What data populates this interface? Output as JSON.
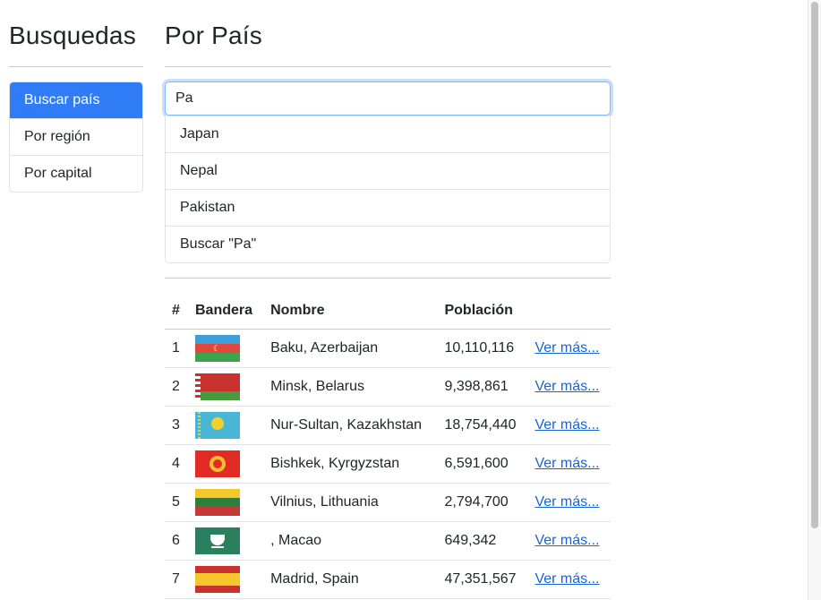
{
  "sidebar": {
    "title": "Busquedas",
    "items": [
      {
        "label": "Buscar país",
        "active": true
      },
      {
        "label": "Por región",
        "active": false
      },
      {
        "label": "Por capital",
        "active": false
      }
    ]
  },
  "main": {
    "title": "Por País",
    "search": {
      "value": "Pa",
      "placeholder": ""
    },
    "suggestions": [
      "Japan",
      "Nepal",
      "Pakistan",
      "Buscar \"Pa\""
    ],
    "table": {
      "headers": [
        "#",
        "Bandera",
        "Nombre",
        "Población",
        ""
      ],
      "rows": [
        {
          "num": "1",
          "flag": "azerbaijan-flag",
          "name": "Baku, Azerbaijan",
          "population": "10,110,116",
          "link": "Ver más..."
        },
        {
          "num": "2",
          "flag": "belarus-flag",
          "name": "Minsk, Belarus",
          "population": "9,398,861",
          "link": "Ver más..."
        },
        {
          "num": "3",
          "flag": "kazakhstan-flag",
          "name": "Nur-Sultan, Kazakhstan",
          "population": "18,754,440",
          "link": "Ver más..."
        },
        {
          "num": "4",
          "flag": "kyrgyzstan-flag",
          "name": "Bishkek, Kyrgyzstan",
          "population": "6,591,600",
          "link": "Ver más..."
        },
        {
          "num": "5",
          "flag": "lithuania-flag",
          "name": "Vilnius, Lithuania",
          "population": "2,794,700",
          "link": "Ver más..."
        },
        {
          "num": "6",
          "flag": "macao-flag",
          "name": ", Macao",
          "population": "649,342",
          "link": "Ver más..."
        },
        {
          "num": "7",
          "flag": "spain-flag",
          "name": "Madrid, Spain",
          "population": "47,351,567",
          "link": "Ver más..."
        }
      ]
    }
  },
  "colors": {
    "accent": "#2f7cf6",
    "link": "#1763d8"
  }
}
